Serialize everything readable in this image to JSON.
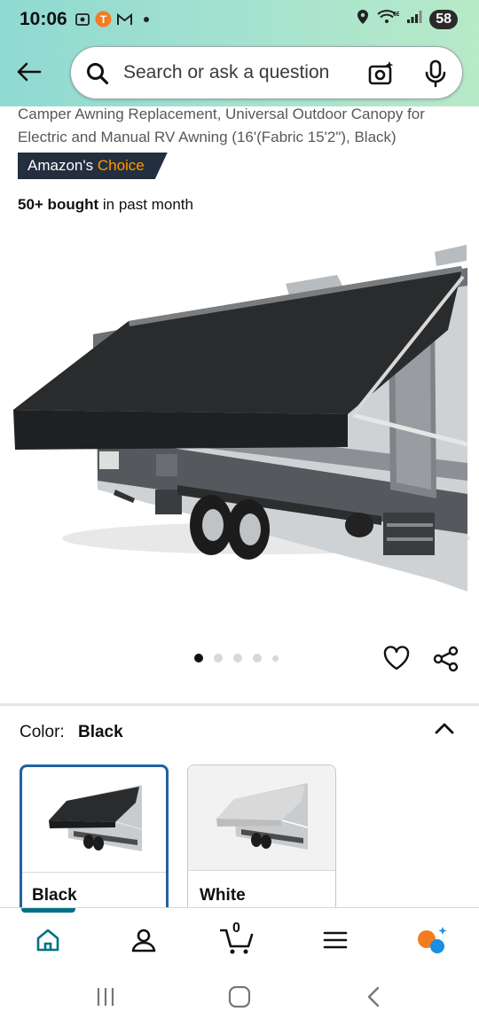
{
  "status_bar": {
    "time": "10:06",
    "battery": "58",
    "network_label": "6E"
  },
  "search": {
    "placeholder": "Search or ask a question"
  },
  "product": {
    "title": "Camper Awning Replacement, Universal Outdoor Canopy for Electric and Manual RV Awning (16'(Fabric 15'2\"), Black)",
    "badge_prefix": "Amazon's",
    "badge_choice": "Choice",
    "bought_bold": "50+ bought",
    "bought_rest": "in past month",
    "image_count": 5,
    "current_image": 1
  },
  "color": {
    "label": "Color:",
    "value": "Black",
    "options": [
      {
        "label": "Black",
        "selected": true
      },
      {
        "label": "White",
        "selected": false
      }
    ]
  },
  "bottom_nav": {
    "items": [
      "home-icon",
      "account-icon",
      "cart-icon",
      "menu-icon",
      "rufus-icon"
    ],
    "cart_count": "0"
  },
  "colors": {
    "accent": "#007185",
    "badge_bg": "#232f3e",
    "badge_choice": "#ff9900",
    "selected_border": "#2162a1"
  }
}
